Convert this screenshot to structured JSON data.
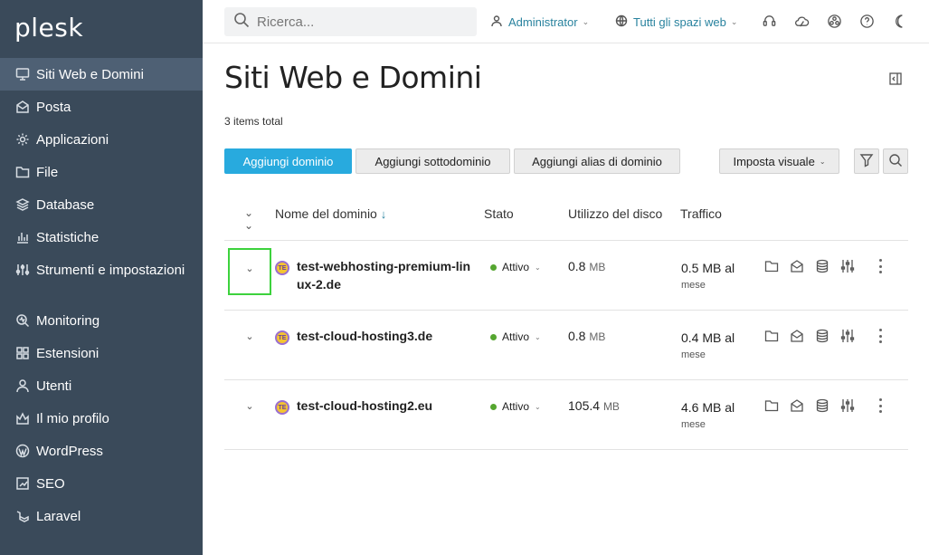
{
  "brand": {
    "logo": "plesk"
  },
  "sidebar": {
    "items": [
      {
        "label": "Siti Web e Domini",
        "icon": "monitor-icon"
      },
      {
        "label": "Posta",
        "icon": "mail-icon"
      },
      {
        "label": "Applicazioni",
        "icon": "gear-icon"
      },
      {
        "label": "File",
        "icon": "folder-icon"
      },
      {
        "label": "Database",
        "icon": "database-icon"
      },
      {
        "label": "Statistiche",
        "icon": "bar-chart-icon"
      },
      {
        "label": "Strumenti e impostazioni",
        "icon": "sliders-icon"
      },
      {
        "label": "Monitoring",
        "icon": "monitoring-icon"
      },
      {
        "label": "Estensioni",
        "icon": "extensions-icon"
      },
      {
        "label": "Utenti",
        "icon": "user-icon"
      },
      {
        "label": "Il mio profilo",
        "icon": "profile-icon"
      },
      {
        "label": "WordPress",
        "icon": "wordpress-icon"
      },
      {
        "label": "SEO",
        "icon": "seo-icon"
      },
      {
        "label": "Laravel",
        "icon": "laravel-icon"
      }
    ],
    "collapse_glyph": "‹"
  },
  "topbar": {
    "search_placeholder": "Ricerca...",
    "user_label": "Administrator",
    "webspace_label": "Tutti gli spazi web"
  },
  "main": {
    "title": "Siti Web e Domini",
    "items_total": "3 items total",
    "toolbar": {
      "add_domain": "Aggiungi dominio",
      "add_subdomain": "Aggiungi sottodominio",
      "add_alias": "Aggiungi alias di dominio",
      "view_settings": "Imposta visuale"
    },
    "table": {
      "columns": {
        "domain": "Nome del dominio",
        "sort_arrow": "↓",
        "status": "Stato",
        "disk": "Utilizzo del disco",
        "traffic": "Traffico"
      },
      "rows": [
        {
          "icon_text": "TE",
          "domain": "test-webhosting-premium-linux-2.de",
          "status": "Attivo",
          "disk_value": "0.8",
          "disk_unit": "MB",
          "traffic_value": "0.5 MB al",
          "traffic_sub": "mese"
        },
        {
          "icon_text": "TE",
          "domain": "test-cloud-hosting3.de",
          "status": "Attivo",
          "disk_value": "0.8",
          "disk_unit": "MB",
          "traffic_value": "0.4 MB al",
          "traffic_sub": "mese"
        },
        {
          "icon_text": "TE",
          "domain": "test-cloud-hosting2.eu",
          "status": "Attivo",
          "disk_value": "105.4",
          "disk_unit": "MB",
          "traffic_value": "4.6 MB al",
          "traffic_sub": "mese"
        }
      ]
    }
  },
  "colors": {
    "sidebar_bg": "#3a4a5a",
    "sidebar_active": "#4e6074",
    "primary_button": "#28aade",
    "link": "#28829e",
    "status_active": "#55a630",
    "focus_outline": "#3dd23d"
  }
}
